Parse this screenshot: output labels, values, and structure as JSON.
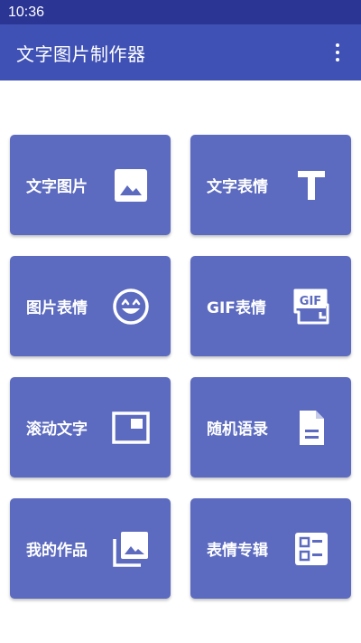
{
  "status_bar": {
    "time": "10:36"
  },
  "app_bar": {
    "title": "文字图片制作器"
  },
  "cards": [
    {
      "label": "文字图片",
      "icon": "image-icon"
    },
    {
      "label": "文字表情",
      "icon": "text-t-icon"
    },
    {
      "label": "图片表情",
      "icon": "smiley-icon"
    },
    {
      "label": "GIF表情",
      "icon": "gif-icon",
      "icon_text": "GIF"
    },
    {
      "label": "滚动文字",
      "icon": "scroll-frame-icon"
    },
    {
      "label": "随机语录",
      "icon": "document-icon"
    },
    {
      "label": "我的作品",
      "icon": "photo-library-icon"
    },
    {
      "label": "表情专辑",
      "icon": "album-list-icon"
    }
  ],
  "colors": {
    "status_bar": "#2b3594",
    "app_bar": "#3f51b5",
    "card": "#5c6bc0"
  }
}
